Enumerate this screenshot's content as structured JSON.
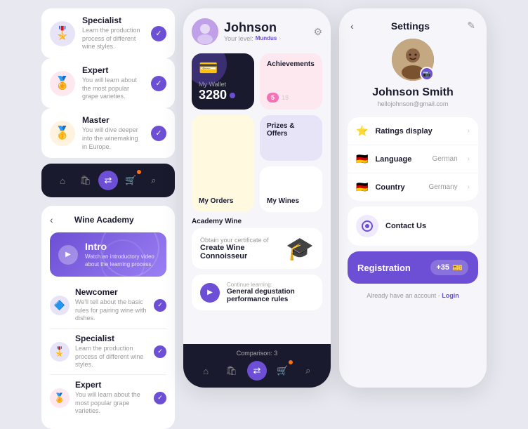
{
  "left": {
    "courses": [
      {
        "id": "specialist",
        "icon": "🎖️",
        "iconClass": "purple",
        "title": "Specialist",
        "desc": "Learn the production process of different wine styles.",
        "checked": true
      },
      {
        "id": "expert",
        "icon": "🏅",
        "iconClass": "pink",
        "title": "Expert",
        "desc": "You will learn about the most popular grape varieties.",
        "checked": true
      },
      {
        "id": "master",
        "icon": "🥇",
        "iconClass": "orange",
        "title": "Master",
        "desc": "You will dive deeper into the winemaking in Europe.",
        "checked": true
      }
    ],
    "nav": {
      "items": [
        {
          "id": "home",
          "icon": "⌂",
          "active": false
        },
        {
          "id": "bag",
          "icon": "🛍",
          "active": false
        },
        {
          "id": "swap",
          "icon": "⇄",
          "active": true
        },
        {
          "id": "cart",
          "icon": "🛒",
          "active": false,
          "badge": true
        },
        {
          "id": "search",
          "icon": "⌕",
          "active": false
        }
      ]
    },
    "academy": {
      "title": "Wine Academy",
      "back": "‹",
      "intro": {
        "label": "Intro",
        "sub": "Watch an introductory video about the learning process."
      },
      "mini_courses": [
        {
          "icon": "🔷",
          "iconClass": "purple",
          "title": "Newcomer",
          "desc": "We'll tell about the basic rules for pairing wine with dishes."
        },
        {
          "icon": "🎖️",
          "iconClass": "purple",
          "title": "Specialist",
          "desc": "Learn the production process of different wine styles."
        },
        {
          "icon": "🏅",
          "iconClass": "pink",
          "title": "Expert",
          "desc": "You will learn about the most popular grape varieties."
        }
      ]
    }
  },
  "center": {
    "user": {
      "name": "Johnson",
      "level_prefix": "Your level:",
      "level": "Mundus",
      "settings_aria": "settings"
    },
    "wallet": {
      "label": "My Wallet",
      "amount": "3280"
    },
    "achievements": {
      "label": "Achievements",
      "count": "5",
      "total": "18"
    },
    "prizes": {
      "label": "Prizes & Offers"
    },
    "orders": {
      "label": "My Orders"
    },
    "wines": {
      "label": "My Wines"
    },
    "academy_wine": {
      "section_label": "Academy Wine",
      "cert_prefix": "Obtain your certificate of",
      "cert_name": "Create Wine Connoisseur"
    },
    "continue": {
      "label": "Continue learning:",
      "title": "General degustation performance rules"
    },
    "bottom_nav": {
      "comparison_label": "Comparison: 3",
      "items": [
        {
          "id": "home",
          "icon": "⌂",
          "active": false
        },
        {
          "id": "bag",
          "icon": "🛍",
          "active": false
        },
        {
          "id": "swap",
          "icon": "⇄",
          "active": true
        },
        {
          "id": "cart",
          "icon": "🛒",
          "active": false,
          "badge": true
        },
        {
          "id": "search",
          "icon": "⌕",
          "active": false
        }
      ]
    }
  },
  "right": {
    "header": {
      "back": "‹",
      "title": "Settings",
      "edit": "✎"
    },
    "profile": {
      "name": "Johnson Smith",
      "email": "hellojohnson@gmail.com"
    },
    "settings_items": [
      {
        "id": "ratings",
        "icon": "⭐",
        "label": "Ratings display",
        "value": "",
        "has_chevron": true
      },
      {
        "id": "language",
        "icon": "🇩🇪",
        "label": "Language",
        "value": "German",
        "has_chevron": true
      },
      {
        "id": "country",
        "icon": "🇩🇪",
        "label": "Country",
        "value": "Germany",
        "has_chevron": true
      }
    ],
    "contact": {
      "icon": "◎",
      "label": "Contact Us"
    },
    "registration": {
      "label": "Registration",
      "count": "+35",
      "icon": "🎫"
    },
    "login_text": "Already have an account -",
    "login_link": "Login"
  }
}
